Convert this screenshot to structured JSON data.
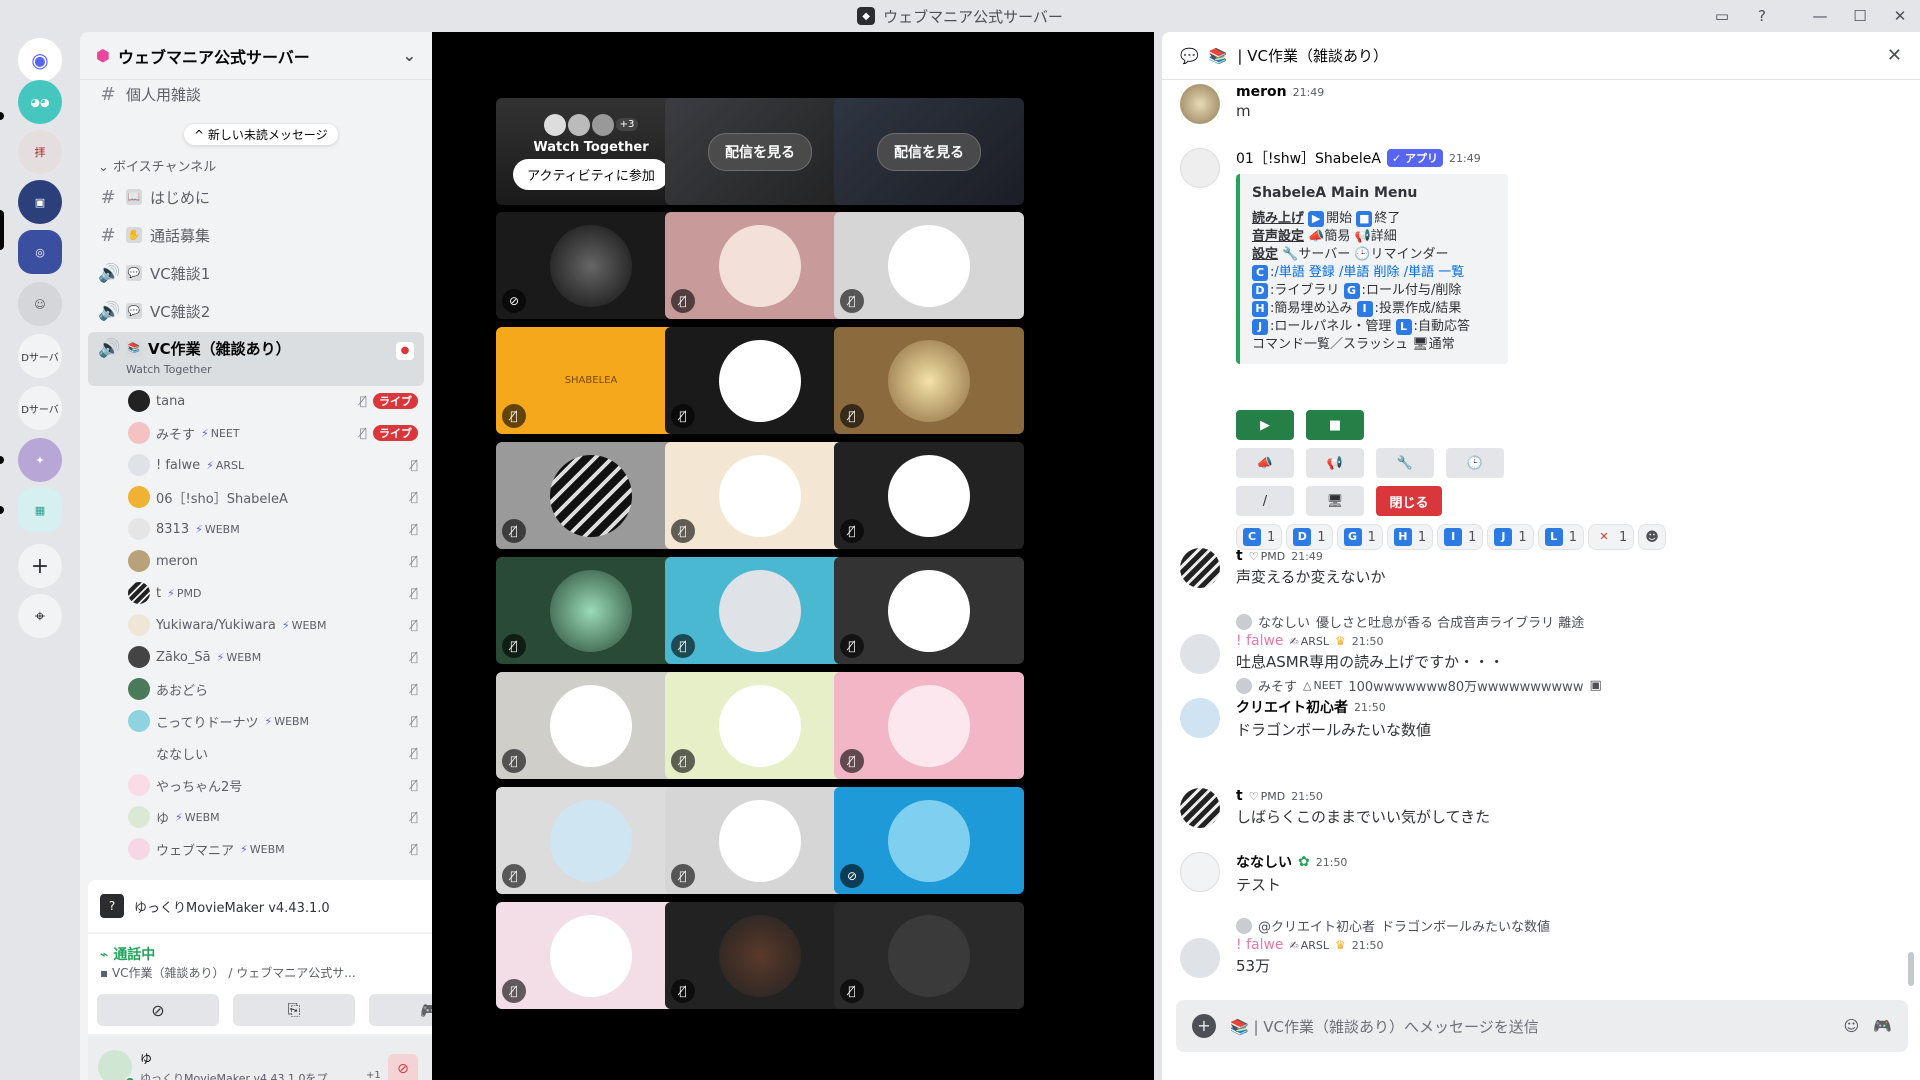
{
  "window": {
    "title": "ウェブマニア公式サーバー"
  },
  "sidebar": {
    "server_name": "ウェブマニア公式サーバー",
    "new_unread": "新しい未読メッセージ",
    "partial_channel": "個人用雑談",
    "category": "ボイスチャンネル",
    "channels": [
      {
        "emoji": "📖",
        "name": "はじめに"
      },
      {
        "emoji": "✋",
        "name": "通話募集"
      },
      {
        "emoji": "💬",
        "name": "VC雑談1"
      },
      {
        "emoji": "💬",
        "name": "VC雑談2"
      }
    ],
    "active_channel": {
      "name": "VC作業（雑談あり）",
      "activity": "Watch Together"
    },
    "voice_users": [
      {
        "name": "tana",
        "tag": "",
        "live": "ライブ"
      },
      {
        "name": "みそす",
        "tag": "NEET",
        "live": "ライブ"
      },
      {
        "name": "! falwe",
        "tag": "ARSL",
        "live": ""
      },
      {
        "name": "06［!sho］ShabeleA",
        "tag": "",
        "live": ""
      },
      {
        "name": "8313",
        "tag": "WEBM",
        "live": ""
      },
      {
        "name": "meron",
        "tag": "",
        "live": ""
      },
      {
        "name": "t",
        "tag": "PMD",
        "live": ""
      },
      {
        "name": "Yukiwara/Yukiwara",
        "tag": "WEBM",
        "live": ""
      },
      {
        "name": "Zāko_Sā",
        "tag": "WEBM",
        "live": ""
      },
      {
        "name": "あおどら",
        "tag": "",
        "live": ""
      },
      {
        "name": "こってりドーナツ",
        "tag": "WEBM",
        "live": ""
      },
      {
        "name": "ななしい",
        "tag": "",
        "live": ""
      },
      {
        "name": "やっちゃん2号",
        "tag": "",
        "live": ""
      },
      {
        "name": "ゆ",
        "tag": "WEBM",
        "live": ""
      },
      {
        "name": "ウェブマニア",
        "tag": "WEBM",
        "live": ""
      }
    ],
    "server_labels": [
      "Dサーバ",
      "Dサーバ"
    ]
  },
  "activity_panel": {
    "name": "ゆっくりMovieMaker v4.43.1.0"
  },
  "voice_panel": {
    "status": "通話中",
    "location": "VC作業（雑談あり） / ウェブマニア公式サ..."
  },
  "user_panel": {
    "name": "ゆ",
    "status": "ゆっくりMovieMaker v4.43.1.0をプ...",
    "extra": "+1"
  },
  "stage": {
    "watch_together": {
      "title": "Watch Together",
      "count": "+3",
      "join_label": "アクティビティに参加"
    },
    "watch_stream_label": "配信を見る",
    "logo_text": "SHABELEA"
  },
  "thread": {
    "title": "VC作業（雑談あり）",
    "composer_placeholder": "VC作業（雑談あり）へメッセージを送信",
    "messages": {
      "m1": {
        "name": "meron",
        "time": "21:49",
        "text": "m"
      },
      "bot": {
        "name": "01［!shw］ShabeleA",
        "app": "アプリ",
        "time": "21:49",
        "embed": {
          "title": "ShabeleA Main Menu",
          "l1_label": "読み上げ",
          "l1_a": "開始",
          "l1_b": "終了",
          "l2_label": "音声設定",
          "l2_a": "簡易",
          "l2_b": "詳細",
          "l3_label": "設定",
          "l3_a": "サーバー",
          "l3_b": "リマインダー",
          "l4_a": "/単語 登録",
          "l4_b": "/単語 削除",
          "l4_c": "/単語 一覧",
          "l5_a": "ライブラリ",
          "l5_b": "ロール付与/削除",
          "l6_a": "簡易埋め込み",
          "l6_b": "投票作成/結果",
          "l7_a": "ロールパネル・管理",
          "l7_b": "自動応答",
          "l8_a": "コマンド一覧／スラッシュ",
          "l8_b": "通常"
        },
        "close_label": "閉じる",
        "reactions": [
          {
            "key": "C",
            "count": "1"
          },
          {
            "key": "D",
            "count": "1"
          },
          {
            "key": "G",
            "count": "1"
          },
          {
            "key": "H",
            "count": "1"
          },
          {
            "key": "I",
            "count": "1"
          },
          {
            "key": "J",
            "count": "1"
          },
          {
            "key": "L",
            "count": "1"
          },
          {
            "key": "✕",
            "count": "1"
          }
        ]
      },
      "m3": {
        "name": "t",
        "tag": "PMD",
        "time": "21:49",
        "text": "声変えるか変えないか"
      },
      "m4": {
        "reply_name": "ななしい",
        "reply_text": "優しさと吐息が香る 合成音声ライブラリ 離途",
        "name": "! falwe",
        "tag": "ARSL",
        "time": "21:50",
        "text": "吐息ASMR専用の読み上げですか・・・"
      },
      "m5": {
        "reply_name": "みそす",
        "reply_tag": "NEET",
        "reply_text": "100wwwwwww80万wwwwwwwwww",
        "name": "クリエイト初心者",
        "time": "21:50",
        "text": "ドラゴンボールみたいな数値"
      },
      "m6": {
        "name": "t",
        "tag": "PMD",
        "time": "21:50",
        "text": "しばらくこのままでいい気がしてきた"
      },
      "m7": {
        "name": "ななしい",
        "time": "21:50",
        "text": "テスト"
      },
      "m8": {
        "reply_name": "@クリエイト初心者",
        "reply_text": "ドラゴンボールみたいな数値",
        "name": "! falwe",
        "tag": "ARSL",
        "time": "21:50",
        "text": "53万"
      }
    }
  },
  "colors": {
    "accent": "#5865f2",
    "live": "#da373c",
    "online": "#23a559",
    "link": "#006ce7"
  }
}
